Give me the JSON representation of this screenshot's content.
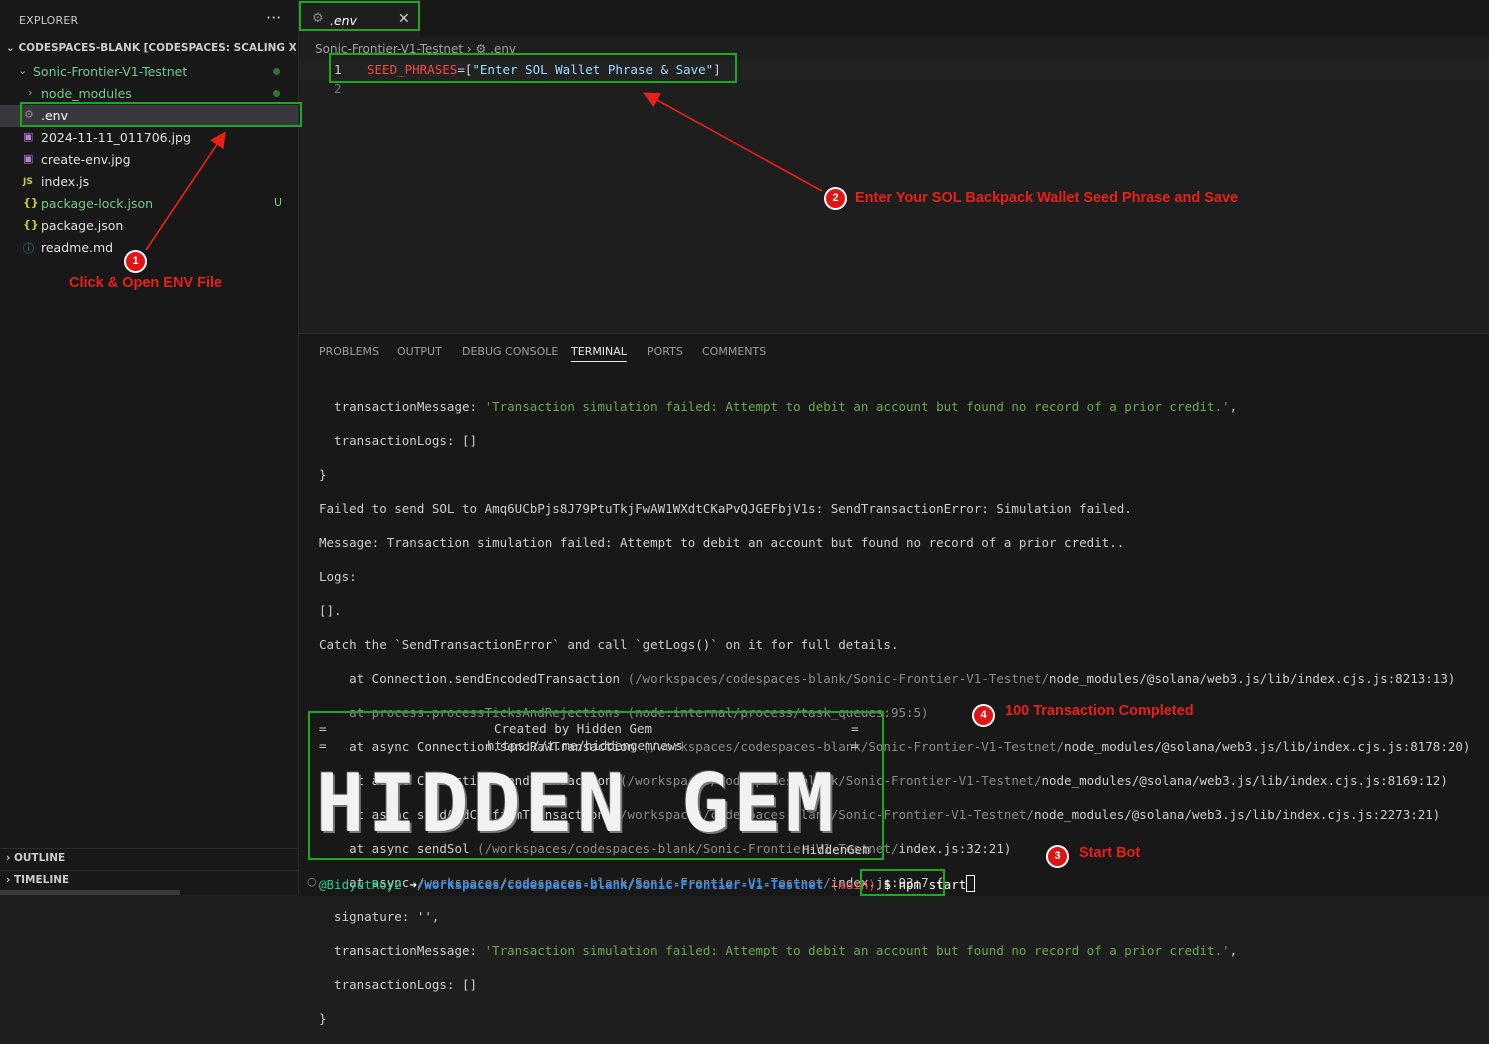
{
  "sidebar": {
    "title": "EXPLORER",
    "more": "···",
    "workspace": "CODESPACES-BLANK [CODESPACES: SCALING XYLO...",
    "folder": "Sonic-Frontier-V1-Testnet",
    "items": [
      {
        "label": "node_modules",
        "icon": "›"
      },
      {
        "label": ".env",
        "icon": "gear-icon"
      },
      {
        "label": "2024-11-11_011706.jpg",
        "icon": "image-icon"
      },
      {
        "label": "create-env.jpg",
        "icon": "image-icon"
      },
      {
        "label": "index.js",
        "icon": "JS"
      },
      {
        "label": "package-lock.json",
        "icon": "{}",
        "status": "U"
      },
      {
        "label": "package.json",
        "icon": "{}"
      },
      {
        "label": "readme.md",
        "icon": "info-icon"
      }
    ],
    "outline": "OUTLINE",
    "timeline": "TIMELINE"
  },
  "editor": {
    "tab": ".env",
    "tab_close": "✕",
    "breadcrumb_folder": "Sonic-Frontier-V1-Testnet",
    "breadcrumb_file": ".env",
    "line1_no": "1",
    "line2_no": "2",
    "code_key": "SEED_PHRASES",
    "code_eq": "=[",
    "code_value": "\"Enter SOL Wallet Phrase & Save\"",
    "code_end": "]"
  },
  "panel": {
    "tabs": [
      "PROBLEMS",
      "OUTPUT",
      "DEBUG CONSOLE",
      "TERMINAL",
      "PORTS",
      "COMMENTS"
    ],
    "active_tab": "TERMINAL"
  },
  "terminal": {
    "l1a": "  transactionMessage: ",
    "l1b": "'Transaction simulation failed: Attempt to debit an account but found no record of a prior credit.'",
    "l1c": ",",
    "l2": "  transactionLogs: []",
    "l3": "}",
    "l4": "Failed to send SOL to Amq6UCbPjs8J79PtuTkjFwAW1WXdtCKaPvQJGEFbjV1s: SendTransactionError: Simulation failed.",
    "l5": "Message: Transaction simulation failed: Attempt to debit an account but found no record of a prior credit..",
    "l6": "Logs:",
    "l7": "[].",
    "l8": "Catch the `SendTransactionError` and call `getLogs()` on it for full details.",
    "s1a": "    at Connection.sendEncodedTransaction ",
    "s1b": "(/workspaces/codespaces-blank/Sonic-Frontier-V1-Testnet/",
    "s1c": "node_modules/@solana/web3.js/lib/index.cjs.js:8213:13)",
    "s2": "    at process.processTicksAndRejections (node:internal/process/task_queues:95:5)",
    "s3a": "    at async Connection.sendRawTransaction ",
    "s3b": "(/workspaces/codespaces-blank/Sonic-Frontier-V1-Testnet/",
    "s3c": "node_modules/@solana/web3.js/lib/index.cjs.js:8178:20)",
    "s4a": "    at async Connection.sendTransaction ",
    "s4b": "(/workspaces/codespaces-blank/Sonic-Frontier-V1-Testnet/",
    "s4c": "node_modules/@solana/web3.js/lib/index.cjs.js:8169:12)",
    "s5a": "    at async sendAndConfirmTransaction ",
    "s5b": "(/workspaces/codespaces-blank/Sonic-Frontier-V1-Testnet/",
    "s5c": "node_modules/@solana/web3.js/lib/index.cjs.js:2273:21)",
    "s6a": "    at async sendSol ",
    "s6b": "(/workspaces/codespaces-blank/Sonic-Frontier-V1-Testnet/",
    "s6c": "index.js:32:21)",
    "s7a": "    at async ",
    "s7b": "/workspaces/codespaces-blank/Sonic-Frontier-V1-Testnet/",
    "s7c": "index.js:93:7 {",
    "l9": "  signature: '',",
    "l10a": "  transactionMessage: ",
    "l10b": "'Transaction simulation failed: Attempt to debit an account but found no record of a prior credit.'",
    "l10c": ",",
    "l11": "  transactionLogs: []",
    "l12": "}",
    "banner_created": "Created by Hidden Gem",
    "banner_url": "https://t.me/hiddengemnews",
    "banner_eq": "=",
    "banner_big": "HIDDEN GEM",
    "banner_small": "HiddenGem",
    "prompt_user": "@BidyutRoy2",
    "prompt_arrow": "➜",
    "prompt_path": "/workspaces/codespaces-blank/Sonic-Frontier-V1-Testnet",
    "prompt_branch": "(main)",
    "prompt_dollar": "$",
    "command": "npm start"
  },
  "annotations": {
    "a1_num": "1",
    "a1_text": "Click & Open ENV File",
    "a2_num": "2",
    "a2_text": "Enter Your SOL Backpack Wallet Seed Phrase and Save",
    "a3_num": "3",
    "a3_text": "Start Bot",
    "a4_num": "4",
    "a4_text": "100 Transaction Completed"
  },
  "colors": {
    "highlight_box": "#1fa81f",
    "annotation_red": "#e8201a",
    "terminal_green": "#6aa84f"
  }
}
